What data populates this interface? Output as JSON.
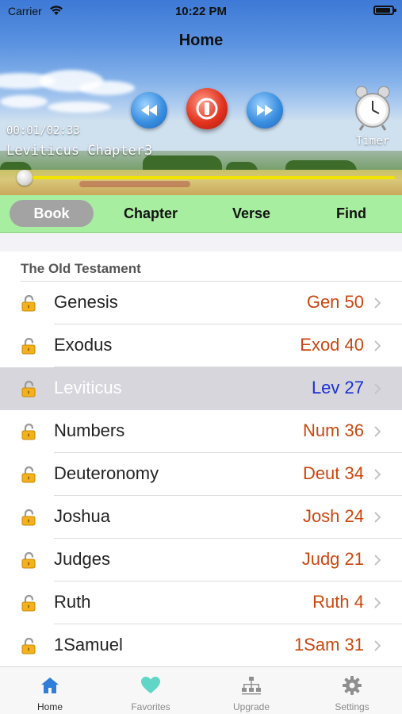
{
  "status_bar": {
    "carrier": "Carrier",
    "time": "10:22 PM"
  },
  "nav": {
    "title": "Home"
  },
  "player": {
    "elapsed": "00:01/02:33",
    "track": "Leviticus Chapter3",
    "timer_label": "Timer",
    "progress_fraction": 0.0065
  },
  "segments": [
    {
      "label": "Book",
      "selected": true
    },
    {
      "label": "Chapter",
      "selected": false
    },
    {
      "label": "Verse",
      "selected": false
    },
    {
      "label": "Find",
      "selected": false
    }
  ],
  "list": {
    "section_title": "The Old Testament",
    "rows": [
      {
        "name": "Genesis",
        "abbr": "Gen 50",
        "selected": false
      },
      {
        "name": "Exodus",
        "abbr": "Exod 40",
        "selected": false
      },
      {
        "name": "Leviticus",
        "abbr": "Lev 27",
        "selected": true
      },
      {
        "name": "Numbers",
        "abbr": "Num 36",
        "selected": false
      },
      {
        "name": "Deuteronomy",
        "abbr": "Deut 34",
        "selected": false
      },
      {
        "name": "Joshua",
        "abbr": "Josh 24",
        "selected": false
      },
      {
        "name": "Judges",
        "abbr": "Judg 21",
        "selected": false
      },
      {
        "name": "Ruth",
        "abbr": "Ruth 4",
        "selected": false
      },
      {
        "name": "1Samuel",
        "abbr": "1Sam 31",
        "selected": false
      }
    ]
  },
  "tabs": [
    {
      "label": "Home",
      "icon": "home-icon",
      "active": true
    },
    {
      "label": "Favorites",
      "icon": "heart-icon",
      "active": false
    },
    {
      "label": "Upgrade",
      "icon": "hierarchy-icon",
      "active": false
    },
    {
      "label": "Settings",
      "icon": "gear-icon",
      "active": false
    }
  ],
  "colors": {
    "accent_blue": "#2f7fd8",
    "segment_bar": "#a8eea0",
    "chapter_count": "#c9470f",
    "selected_chapter_count": "#1b2fd6",
    "progress": "#f1e400"
  }
}
